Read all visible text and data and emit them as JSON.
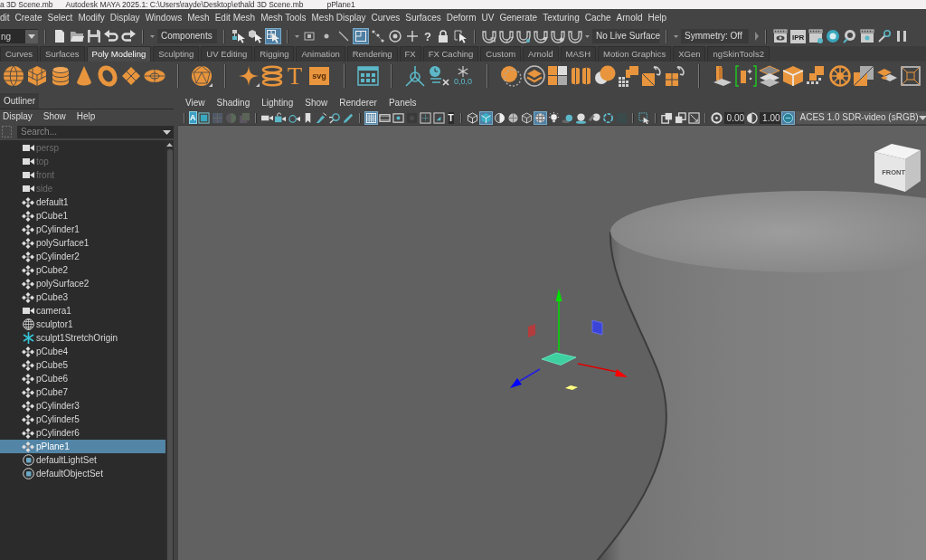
{
  "title_bar": {
    "segments": [
      "a 3D Scene.mb",
      "Autodesk MAYA 2025.1: C:\\Users\\rayde\\Desktop\\ethald 3D Scene.mb",
      "pPlane1"
    ]
  },
  "menu_bar": {
    "items": [
      "dit",
      "Create",
      "Select",
      "Modify",
      "Display",
      "Windows",
      "Mesh",
      "Edit Mesh",
      "Mesh Tools",
      "Mesh Display",
      "Curves",
      "Surfaces",
      "Deform",
      "UV",
      "Generate",
      "Texturing",
      "Cache",
      "Arnold",
      "Help"
    ]
  },
  "status_line": {
    "menu_set": "ng",
    "selection_mask": "Components",
    "select_modes": [
      {
        "selected": false
      },
      {
        "selected": false
      },
      {
        "selected": true
      }
    ],
    "mask_toggles": [
      {
        "on": false
      },
      {
        "on": false
      },
      {
        "on": false
      },
      {
        "on": true
      }
    ],
    "mask_misc_label": "?",
    "live_surface": "No Live Surface",
    "symmetry": "Symmetry: Off",
    "ipr_label": "IPR"
  },
  "shelf_tabs": [
    {
      "label": "Curves",
      "selected": false
    },
    {
      "label": "Surfaces",
      "selected": false
    },
    {
      "label": "Poly Modeling",
      "selected": true
    },
    {
      "label": "Sculpting",
      "selected": false
    },
    {
      "label": "UV Editing",
      "selected": false
    },
    {
      "label": "Rigging",
      "selected": false
    },
    {
      "label": "Animation",
      "selected": false
    },
    {
      "label": "Rendering",
      "selected": false
    },
    {
      "label": "FX",
      "selected": false
    },
    {
      "label": "FX Caching",
      "selected": false
    },
    {
      "label": "Custom",
      "selected": false
    },
    {
      "label": "Arnold",
      "selected": false
    },
    {
      "label": "MASH",
      "selected": false
    },
    {
      "label": "Motion Graphics",
      "selected": false
    },
    {
      "label": "XGen",
      "selected": false
    },
    {
      "label": "ngSkinTools2",
      "selected": false
    }
  ],
  "shelf": {
    "text_tool": "T",
    "svg_tool": "svg",
    "pivot_label": "0,0,0"
  },
  "outliner": {
    "tab": "Outliner",
    "menu": [
      "Display",
      "Show",
      "Help"
    ],
    "search": {
      "placeholder": "Search..."
    },
    "items": [
      {
        "label": "persp",
        "kind": "camera",
        "dimmed": true,
        "selected": false
      },
      {
        "label": "top",
        "kind": "camera",
        "dimmed": true,
        "selected": false
      },
      {
        "label": "front",
        "kind": "camera",
        "dimmed": true,
        "selected": false
      },
      {
        "label": "side",
        "kind": "camera",
        "dimmed": true,
        "selected": false
      },
      {
        "label": "default1",
        "kind": "transform",
        "dimmed": false,
        "selected": false
      },
      {
        "label": "pCube1",
        "kind": "transform",
        "dimmed": false,
        "selected": false
      },
      {
        "label": "pCylinder1",
        "kind": "transform",
        "dimmed": false,
        "selected": false
      },
      {
        "label": "polySurface1",
        "kind": "transform",
        "dimmed": false,
        "selected": false
      },
      {
        "label": "pCylinder2",
        "kind": "transform",
        "dimmed": false,
        "selected": false
      },
      {
        "label": "pCube2",
        "kind": "transform",
        "dimmed": false,
        "selected": false
      },
      {
        "label": "polySurface2",
        "kind": "transform",
        "dimmed": false,
        "selected": false
      },
      {
        "label": "pCube3",
        "kind": "transform",
        "dimmed": false,
        "selected": false
      },
      {
        "label": "camera1",
        "kind": "camera",
        "dimmed": false,
        "selected": false
      },
      {
        "label": "sculptor1",
        "kind": "sculptor",
        "dimmed": false,
        "selected": false
      },
      {
        "label": "sculpt1StretchOrigin",
        "kind": "locator",
        "dimmed": false,
        "selected": false
      },
      {
        "label": "pCube4",
        "kind": "transform",
        "dimmed": false,
        "selected": false
      },
      {
        "label": "pCube5",
        "kind": "transform",
        "dimmed": false,
        "selected": false
      },
      {
        "label": "pCube6",
        "kind": "transform",
        "dimmed": false,
        "selected": false
      },
      {
        "label": "pCube7",
        "kind": "transform",
        "dimmed": false,
        "selected": false
      },
      {
        "label": "pCylinder3",
        "kind": "transform",
        "dimmed": false,
        "selected": false
      },
      {
        "label": "pCylinder5",
        "kind": "transform",
        "dimmed": false,
        "selected": false
      },
      {
        "label": "pCylinder6",
        "kind": "transform",
        "dimmed": false,
        "selected": false
      },
      {
        "label": "pPlane1",
        "kind": "transform",
        "dimmed": false,
        "selected": true
      },
      {
        "label": "defaultLightSet",
        "kind": "set",
        "dimmed": false,
        "selected": false
      },
      {
        "label": "defaultObjectSet",
        "kind": "set",
        "dimmed": false,
        "selected": false
      }
    ]
  },
  "viewport": {
    "menu": [
      "View",
      "Shading",
      "Lighting",
      "Show",
      "Renderer",
      "Panels"
    ],
    "camera_label": "A",
    "text_label": "T",
    "toggles": [
      {
        "on": true
      },
      {
        "on": true
      },
      {
        "on": false
      },
      {
        "on": true
      },
      {
        "on": true
      },
      {
        "on": true
      }
    ],
    "exposure": "0.00",
    "gamma": "1.00",
    "color_space": "ACES 1.0 SDR-video (sRGB)",
    "view_cube_label": "FRONT"
  }
}
